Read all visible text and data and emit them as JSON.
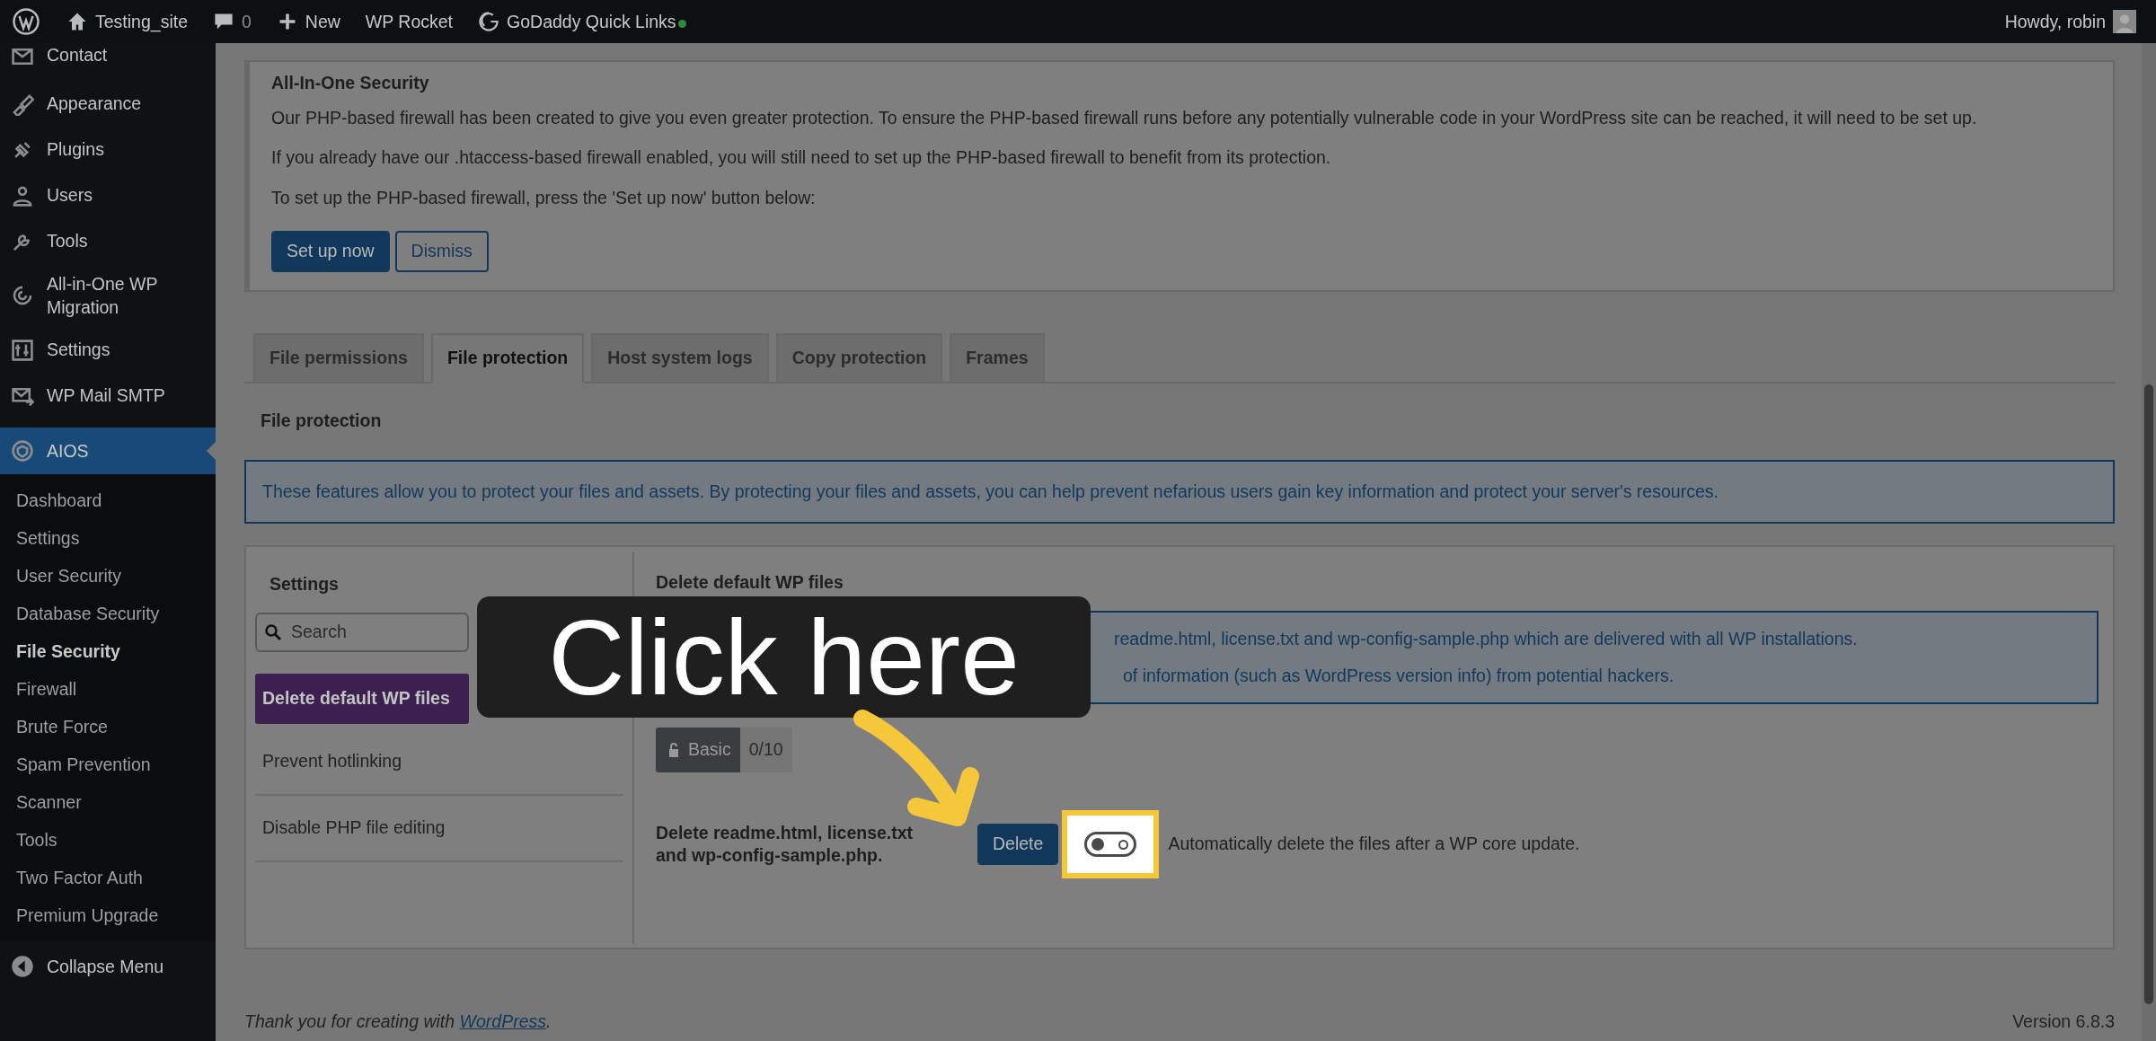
{
  "admin_bar": {
    "site": "Testing_site",
    "comments": "0",
    "new": "New",
    "items": [
      "WP Rocket",
      "GoDaddy Quick Links"
    ],
    "status_dot": {
      "color": "#2e8b3a"
    },
    "user": "Howdy, robin"
  },
  "sidebar": {
    "menu": [
      {
        "label": "Contact",
        "selected": false
      },
      {
        "label": "Appearance",
        "selected": false
      },
      {
        "label": "Plugins",
        "selected": false
      },
      {
        "label": "Users",
        "selected": false
      },
      {
        "label": "Tools",
        "selected": false
      },
      {
        "label": "All-in-One WP Migration",
        "selected": false
      },
      {
        "label": "Settings",
        "selected": false
      },
      {
        "label": "WP Mail SMTP",
        "selected": false
      },
      {
        "label": "AIOS",
        "selected": true
      }
    ],
    "submenu": [
      {
        "label": "Dashboard",
        "selected": false
      },
      {
        "label": "Settings",
        "selected": false
      },
      {
        "label": "User Security",
        "selected": false
      },
      {
        "label": "Database Security",
        "selected": false
      },
      {
        "label": "File Security",
        "selected": true
      },
      {
        "label": "Firewall",
        "selected": false
      },
      {
        "label": "Brute Force",
        "selected": false
      },
      {
        "label": "Spam Prevention",
        "selected": false
      },
      {
        "label": "Scanner",
        "selected": false
      },
      {
        "label": "Tools",
        "selected": false
      },
      {
        "label": "Two Factor Auth",
        "selected": false
      },
      {
        "label": "Premium Upgrade",
        "selected": false
      }
    ],
    "collapse": "Collapse Menu"
  },
  "notice": {
    "title": "All-In-One Security",
    "paragraphs": [
      "Our PHP-based firewall has been created to give you even greater protection. To ensure the PHP-based firewall runs before any potentially vulnerable code in your WordPress site can be reached, it will need to be set up.",
      "If you already have our .htaccess-based firewall enabled, you will still need to set up the PHP-based firewall to benefit from its protection.",
      "To set up the PHP-based firewall, press the 'Set up now' button below:"
    ],
    "primary_button": "Set up now",
    "secondary_button": "Dismiss"
  },
  "tabs": [
    {
      "label": "File permissions",
      "selected": false
    },
    {
      "label": "File protection",
      "selected": true
    },
    {
      "label": "Host system logs",
      "selected": false
    },
    {
      "label": "Copy protection",
      "selected": false
    },
    {
      "label": "Frames",
      "selected": false
    }
  ],
  "section_title": "File protection",
  "section_info": "These features allow you to protect your files and assets. By protecting your files and assets, you can help prevent nefarious users gain key information and protect your server's resources.",
  "settings": {
    "title": "Settings",
    "search": {
      "placeholder": "Search"
    },
    "items": [
      {
        "label": "Delete default WP files",
        "selected": true
      },
      {
        "label": "Prevent hotlinking",
        "selected": false
      },
      {
        "label": "Disable PHP file editing",
        "selected": false
      }
    ]
  },
  "feature": {
    "title": "Delete default WP files",
    "info": [
      "readme.html, license.txt and wp-config-sample.php which are delivered with all WP installations.",
      "of information (such as WordPress version info) from potential hackers."
    ],
    "badge": "Basic",
    "score": "0/10",
    "label": "Delete readme.html, license.txt and wp-config-sample.php.",
    "button": "Delete",
    "toggle": {
      "on": false
    },
    "toggle_label": "Automatically delete the files after a WP core update."
  },
  "footer": {
    "thanks": "Thank you for creating with ",
    "link": "WordPress",
    "after": ".",
    "version": "Version 6.8.3"
  },
  "callout": {
    "text": "Click here"
  }
}
